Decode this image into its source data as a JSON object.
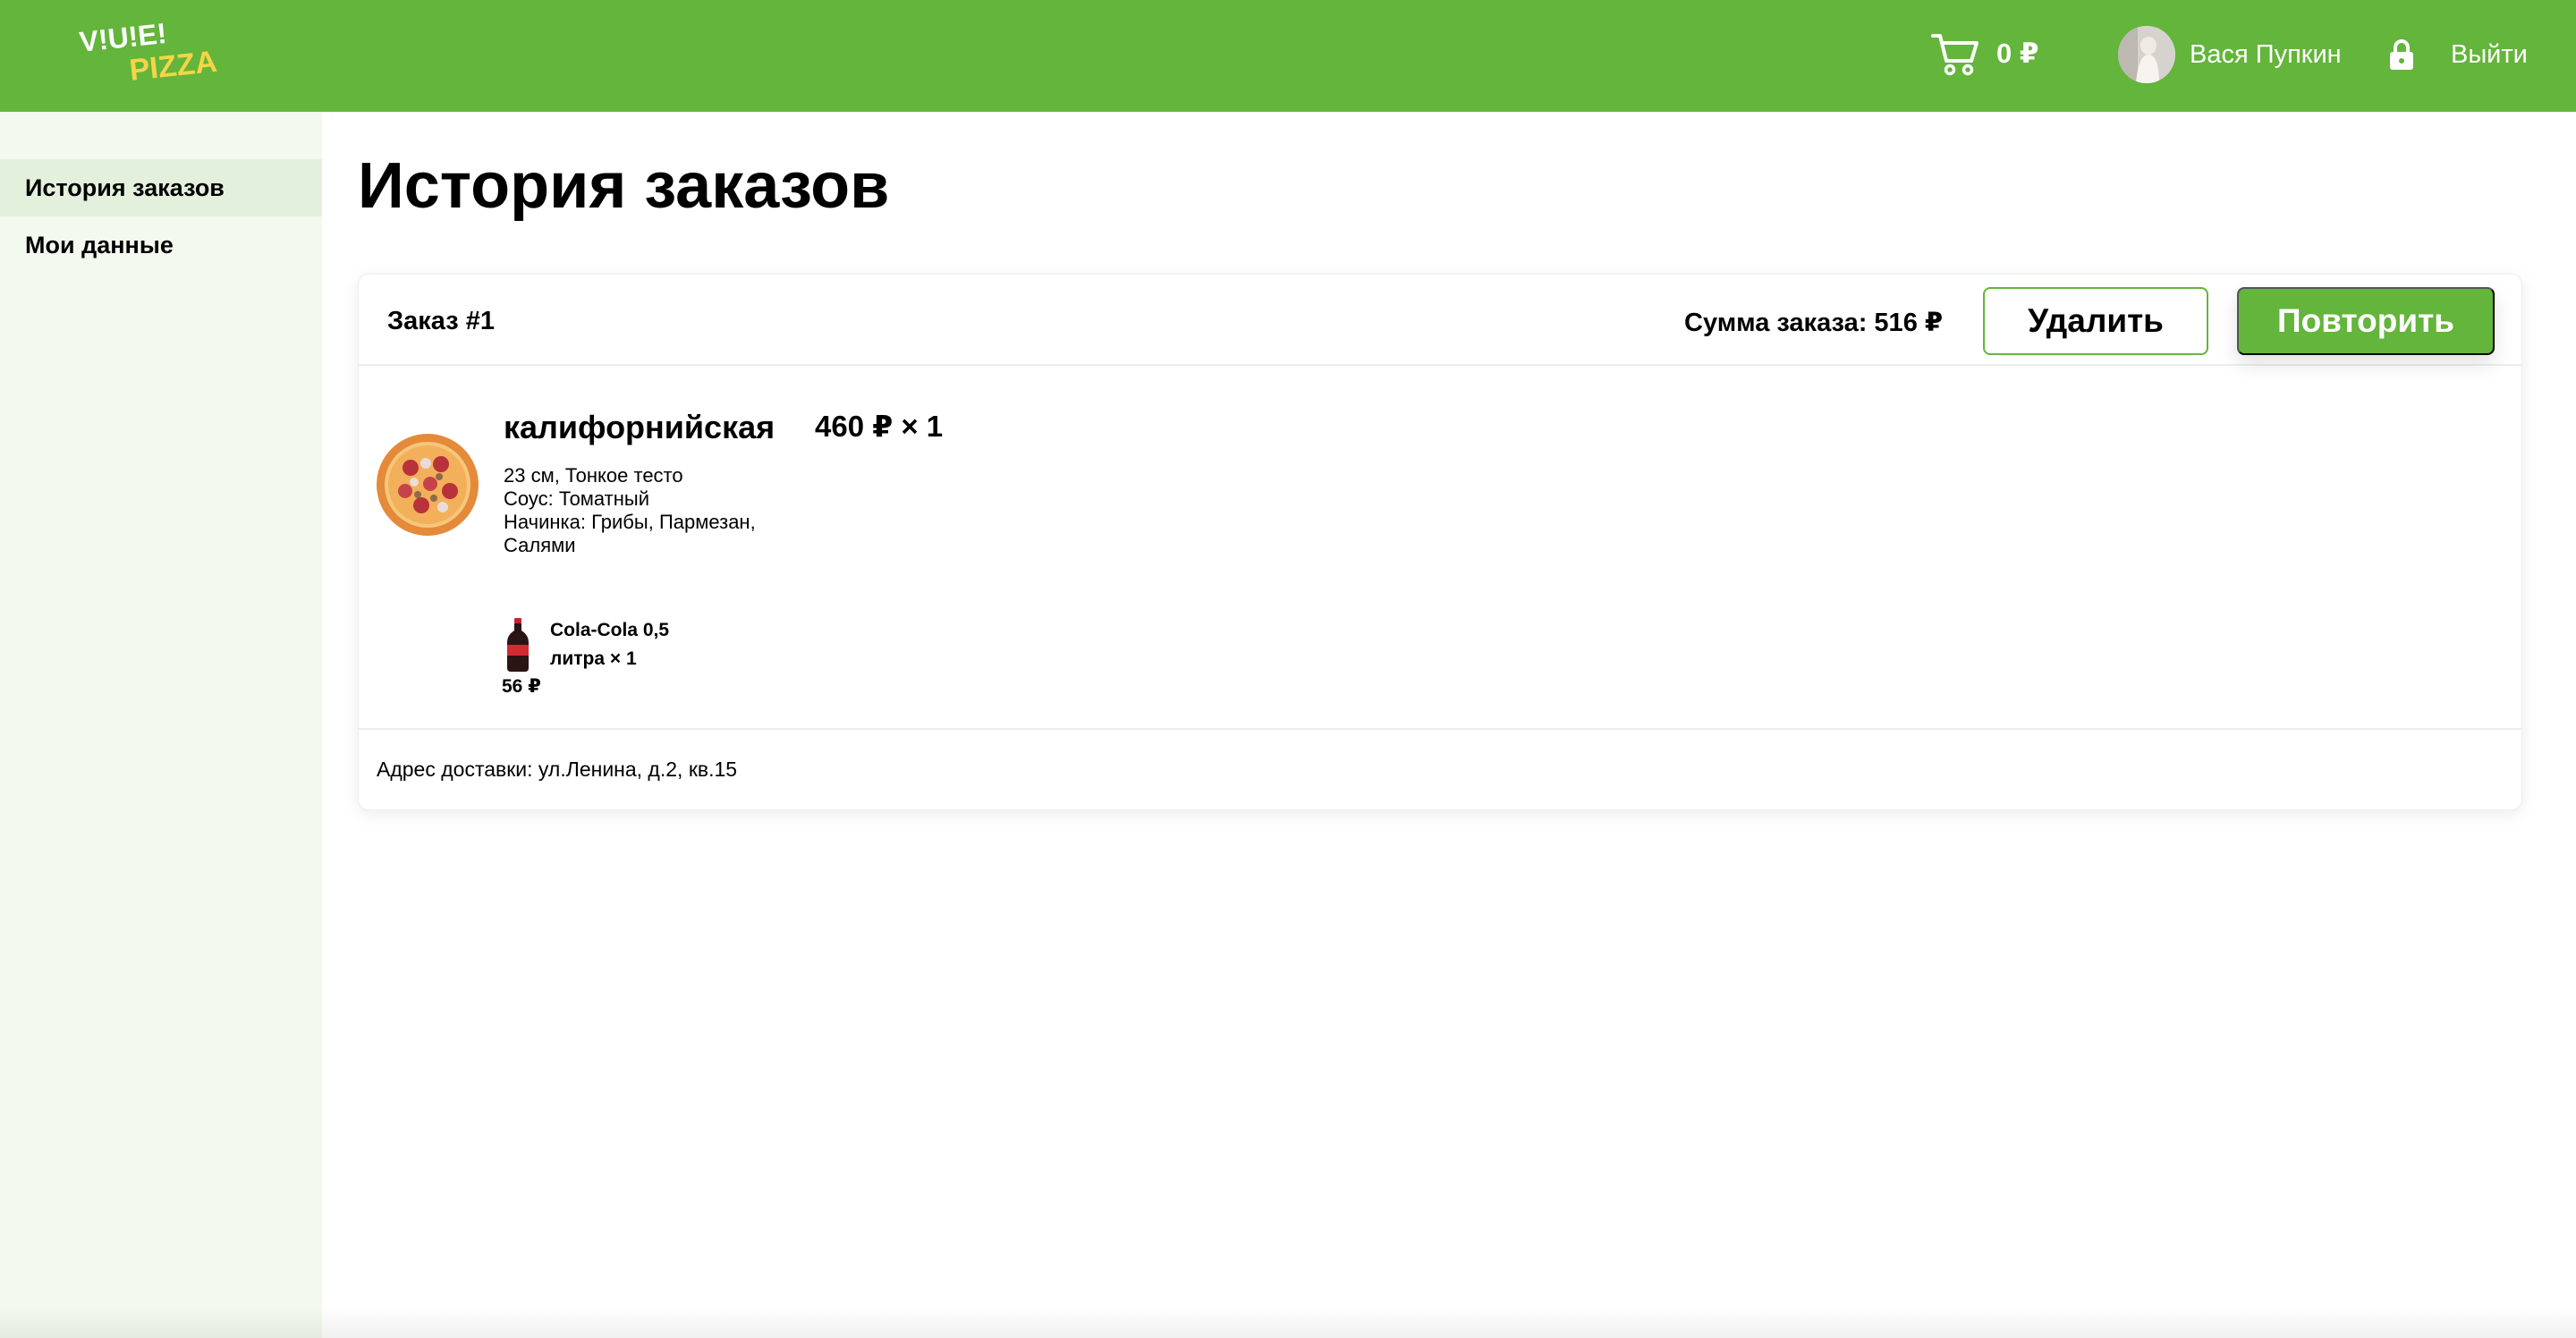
{
  "header": {
    "logo_text_top": "V!U!E!",
    "logo_text_bottom": "PIZZA",
    "cart_amount": "0 ₽",
    "user_name": "Вася Пупкин",
    "logout_label": "Выйти"
  },
  "sidebar": {
    "items": [
      {
        "label": "История заказов",
        "active": true
      },
      {
        "label": "Мои данные",
        "active": false
      }
    ]
  },
  "page": {
    "title": "История заказов"
  },
  "order": {
    "number": "Заказ #1",
    "sum": "Сумма заказа: 516 ₽",
    "delete_label": "Удалить",
    "repeat_label": "Повторить",
    "pizza": {
      "name": "калифорнийская",
      "price": "460 ₽ × 1",
      "size": "23 см, Тонкое тесто",
      "sauce": "Соус: Томатный",
      "filling_line1": "Начинка: Грибы, Пармезан,",
      "filling_line2": "Салями"
    },
    "drink": {
      "name": "Cola-Cola 0,5 литра × 1",
      "price": "56 ₽"
    },
    "address": "Адрес доставки: ул.Ленина, д.2, кв.15"
  },
  "colors": {
    "brand_green": "#63b53b",
    "logo_yellow": "#f5d547",
    "sidebar_bg": "#f2f9ef",
    "sidebar_active": "#e3f1dc"
  },
  "icons": {
    "cart": "cart-icon",
    "lock": "lock-icon"
  }
}
